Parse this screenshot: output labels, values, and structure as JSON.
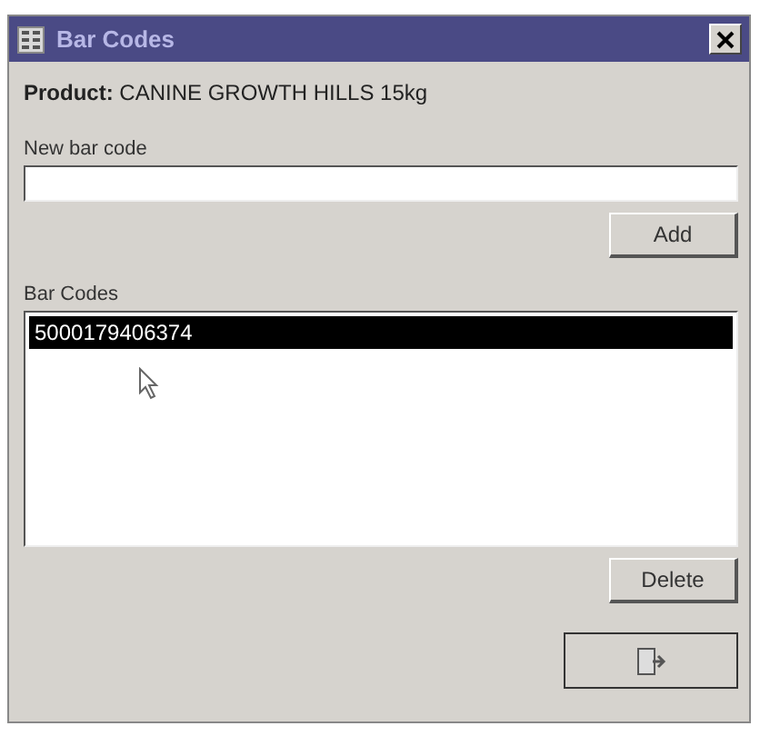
{
  "window": {
    "title": "Bar Codes"
  },
  "product": {
    "label": "Product:",
    "value": "CANINE GROWTH HILLS 15kg"
  },
  "new_bar_code": {
    "label": "New bar code"
  },
  "add_button": "Add",
  "bar_codes": {
    "label": "Bar Codes",
    "items": [
      {
        "text": "5000179406374",
        "selected": true
      }
    ]
  },
  "delete_button": "Delete"
}
